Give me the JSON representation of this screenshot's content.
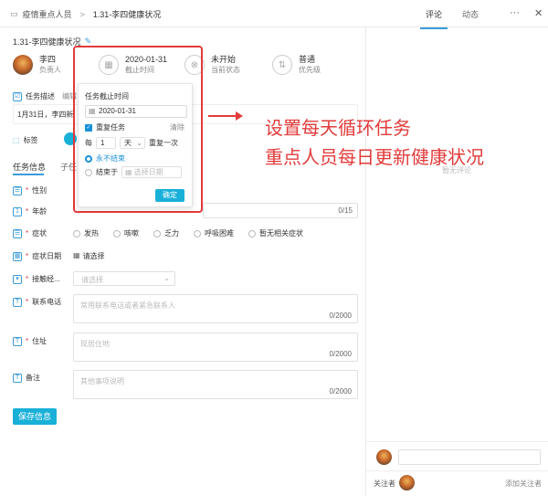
{
  "breadcrumb": {
    "parent": "疫情重点人员",
    "separator": ">",
    "current": "1.31-李四健康状况"
  },
  "right_tabs": {
    "comments": "评论",
    "activity": "动态"
  },
  "top_icons": {
    "more": "more-icon",
    "close": "close-icon"
  },
  "task_title": "1.31-李四健康状况",
  "owner": {
    "name": "李四",
    "role": "负责人"
  },
  "deadline": {
    "value": "2020-01-31",
    "label": "截止时间"
  },
  "status": {
    "value": "未开始",
    "label": "当前状态"
  },
  "priority": {
    "value": "普通",
    "label": "优先级"
  },
  "description": {
    "label": "任务描述",
    "edit": "编辑",
    "text": "1月31日，李四新"
  },
  "tags_label": "标签",
  "tabs": {
    "info": "任务信息",
    "sub": "子任"
  },
  "popup": {
    "title": "任务截止时间",
    "date": "2020-01-31",
    "repeat_label": "重复任务",
    "clear": "清除",
    "every": "每",
    "interval": "1",
    "unit": "天",
    "repeat_once": "重复一次",
    "never_end": "永不结束",
    "end_at": "结束于",
    "end_placeholder": "选择日期",
    "confirm": "确定"
  },
  "annotation": {
    "line1": "设置每天循环任务",
    "line2": "重点人员每日更新健康状况"
  },
  "no_comments": "暂无评论",
  "fields": {
    "gender": "性别",
    "age": "年龄",
    "age_counter": "0/15",
    "symptoms": "症状",
    "symptom_options": [
      "发热",
      "咳嗽",
      "乏力",
      "呼吸困难",
      "暂无相关症状"
    ],
    "symptom_date": "症状日期",
    "symptom_date_value": "请选择",
    "contact": "接触经...",
    "contact_placeholder": "请选择",
    "phone": "联系电话",
    "phone_placeholder": "常用联系电话或者紧急联系人",
    "phone_counter": "0/2000",
    "address": "住址",
    "address_placeholder": "现居住地",
    "address_counter": "0/2000",
    "note": "备注",
    "note_placeholder": "其他事项说明",
    "note_counter": "0/2000"
  },
  "save_button": "保存信息",
  "followers": {
    "label": "关注者",
    "add": "添加关注者"
  }
}
